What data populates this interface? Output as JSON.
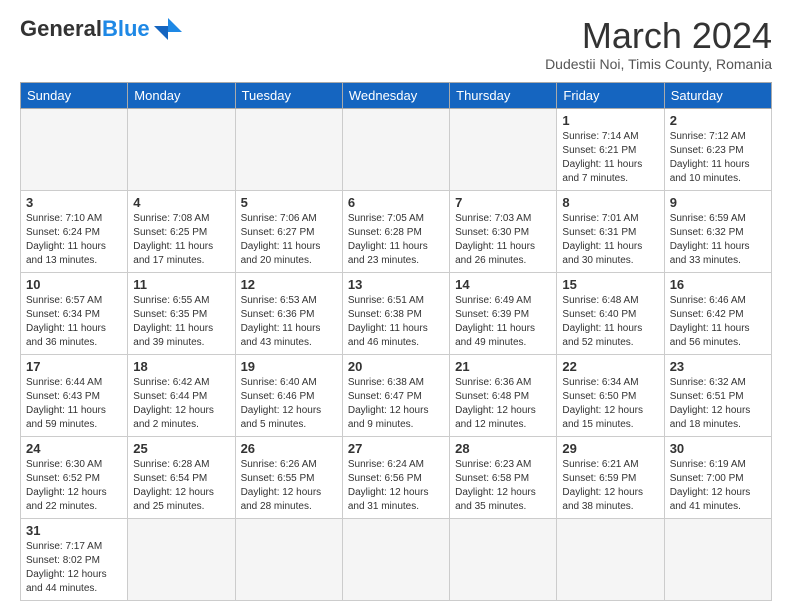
{
  "header": {
    "logo_general": "General",
    "logo_blue": "Blue",
    "month_title": "March 2024",
    "subtitle": "Dudestii Noi, Timis County, Romania"
  },
  "weekdays": [
    "Sunday",
    "Monday",
    "Tuesday",
    "Wednesday",
    "Thursday",
    "Friday",
    "Saturday"
  ],
  "weeks": [
    [
      {
        "day": "",
        "info": "",
        "empty": true
      },
      {
        "day": "",
        "info": "",
        "empty": true
      },
      {
        "day": "",
        "info": "",
        "empty": true
      },
      {
        "day": "",
        "info": "",
        "empty": true
      },
      {
        "day": "",
        "info": "",
        "empty": true
      },
      {
        "day": "1",
        "info": "Sunrise: 7:14 AM\nSunset: 6:21 PM\nDaylight: 11 hours\nand 7 minutes."
      },
      {
        "day": "2",
        "info": "Sunrise: 7:12 AM\nSunset: 6:23 PM\nDaylight: 11 hours\nand 10 minutes."
      }
    ],
    [
      {
        "day": "3",
        "info": "Sunrise: 7:10 AM\nSunset: 6:24 PM\nDaylight: 11 hours\nand 13 minutes."
      },
      {
        "day": "4",
        "info": "Sunrise: 7:08 AM\nSunset: 6:25 PM\nDaylight: 11 hours\nand 17 minutes."
      },
      {
        "day": "5",
        "info": "Sunrise: 7:06 AM\nSunset: 6:27 PM\nDaylight: 11 hours\nand 20 minutes."
      },
      {
        "day": "6",
        "info": "Sunrise: 7:05 AM\nSunset: 6:28 PM\nDaylight: 11 hours\nand 23 minutes."
      },
      {
        "day": "7",
        "info": "Sunrise: 7:03 AM\nSunset: 6:30 PM\nDaylight: 11 hours\nand 26 minutes."
      },
      {
        "day": "8",
        "info": "Sunrise: 7:01 AM\nSunset: 6:31 PM\nDaylight: 11 hours\nand 30 minutes."
      },
      {
        "day": "9",
        "info": "Sunrise: 6:59 AM\nSunset: 6:32 PM\nDaylight: 11 hours\nand 33 minutes."
      }
    ],
    [
      {
        "day": "10",
        "info": "Sunrise: 6:57 AM\nSunset: 6:34 PM\nDaylight: 11 hours\nand 36 minutes."
      },
      {
        "day": "11",
        "info": "Sunrise: 6:55 AM\nSunset: 6:35 PM\nDaylight: 11 hours\nand 39 minutes."
      },
      {
        "day": "12",
        "info": "Sunrise: 6:53 AM\nSunset: 6:36 PM\nDaylight: 11 hours\nand 43 minutes."
      },
      {
        "day": "13",
        "info": "Sunrise: 6:51 AM\nSunset: 6:38 PM\nDaylight: 11 hours\nand 46 minutes."
      },
      {
        "day": "14",
        "info": "Sunrise: 6:49 AM\nSunset: 6:39 PM\nDaylight: 11 hours\nand 49 minutes."
      },
      {
        "day": "15",
        "info": "Sunrise: 6:48 AM\nSunset: 6:40 PM\nDaylight: 11 hours\nand 52 minutes."
      },
      {
        "day": "16",
        "info": "Sunrise: 6:46 AM\nSunset: 6:42 PM\nDaylight: 11 hours\nand 56 minutes."
      }
    ],
    [
      {
        "day": "17",
        "info": "Sunrise: 6:44 AM\nSunset: 6:43 PM\nDaylight: 11 hours\nand 59 minutes."
      },
      {
        "day": "18",
        "info": "Sunrise: 6:42 AM\nSunset: 6:44 PM\nDaylight: 12 hours\nand 2 minutes."
      },
      {
        "day": "19",
        "info": "Sunrise: 6:40 AM\nSunset: 6:46 PM\nDaylight: 12 hours\nand 5 minutes."
      },
      {
        "day": "20",
        "info": "Sunrise: 6:38 AM\nSunset: 6:47 PM\nDaylight: 12 hours\nand 9 minutes."
      },
      {
        "day": "21",
        "info": "Sunrise: 6:36 AM\nSunset: 6:48 PM\nDaylight: 12 hours\nand 12 minutes."
      },
      {
        "day": "22",
        "info": "Sunrise: 6:34 AM\nSunset: 6:50 PM\nDaylight: 12 hours\nand 15 minutes."
      },
      {
        "day": "23",
        "info": "Sunrise: 6:32 AM\nSunset: 6:51 PM\nDaylight: 12 hours\nand 18 minutes."
      }
    ],
    [
      {
        "day": "24",
        "info": "Sunrise: 6:30 AM\nSunset: 6:52 PM\nDaylight: 12 hours\nand 22 minutes."
      },
      {
        "day": "25",
        "info": "Sunrise: 6:28 AM\nSunset: 6:54 PM\nDaylight: 12 hours\nand 25 minutes."
      },
      {
        "day": "26",
        "info": "Sunrise: 6:26 AM\nSunset: 6:55 PM\nDaylight: 12 hours\nand 28 minutes."
      },
      {
        "day": "27",
        "info": "Sunrise: 6:24 AM\nSunset: 6:56 PM\nDaylight: 12 hours\nand 31 minutes."
      },
      {
        "day": "28",
        "info": "Sunrise: 6:23 AM\nSunset: 6:58 PM\nDaylight: 12 hours\nand 35 minutes."
      },
      {
        "day": "29",
        "info": "Sunrise: 6:21 AM\nSunset: 6:59 PM\nDaylight: 12 hours\nand 38 minutes."
      },
      {
        "day": "30",
        "info": "Sunrise: 6:19 AM\nSunset: 7:00 PM\nDaylight: 12 hours\nand 41 minutes."
      }
    ],
    [
      {
        "day": "31",
        "info": "Sunrise: 7:17 AM\nSunset: 8:02 PM\nDaylight: 12 hours\nand 44 minutes."
      },
      {
        "day": "",
        "info": "",
        "empty": true
      },
      {
        "day": "",
        "info": "",
        "empty": true
      },
      {
        "day": "",
        "info": "",
        "empty": true
      },
      {
        "day": "",
        "info": "",
        "empty": true
      },
      {
        "day": "",
        "info": "",
        "empty": true
      },
      {
        "day": "",
        "info": "",
        "empty": true
      }
    ]
  ]
}
